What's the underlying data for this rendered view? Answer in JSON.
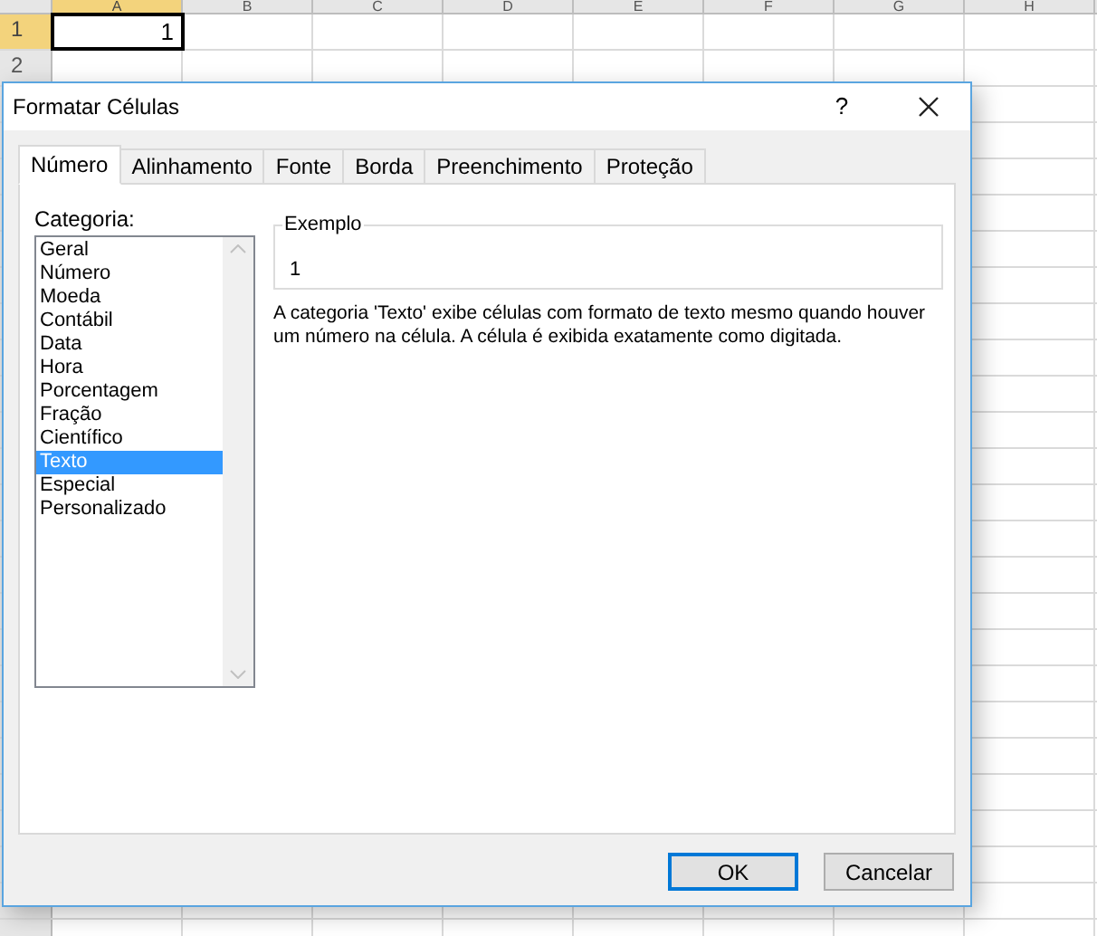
{
  "sheet": {
    "columns": [
      {
        "label": "A",
        "selected": true
      },
      {
        "label": "B",
        "selected": false
      },
      {
        "label": "C",
        "selected": false
      },
      {
        "label": "D",
        "selected": false
      },
      {
        "label": "E",
        "selected": false
      },
      {
        "label": "F",
        "selected": false
      },
      {
        "label": "G",
        "selected": false
      },
      {
        "label": "H",
        "selected": false
      }
    ],
    "rows": [
      {
        "number": "1",
        "value": "1",
        "selected": true
      },
      {
        "number": "2",
        "value": "",
        "selected": false
      }
    ]
  },
  "dialog": {
    "title": "Formatar Células",
    "help": "?",
    "tabs": [
      {
        "label": "Número",
        "selected": true
      },
      {
        "label": "Alinhamento",
        "selected": false
      },
      {
        "label": "Fonte",
        "selected": false
      },
      {
        "label": "Borda",
        "selected": false
      },
      {
        "label": "Preenchimento",
        "selected": false
      },
      {
        "label": "Proteção",
        "selected": false
      }
    ],
    "category_label": "Categoria:",
    "categories": [
      {
        "label": "Geral",
        "selected": false
      },
      {
        "label": "Número",
        "selected": false
      },
      {
        "label": "Moeda",
        "selected": false
      },
      {
        "label": "Contábil",
        "selected": false
      },
      {
        "label": "Data",
        "selected": false
      },
      {
        "label": "Hora",
        "selected": false
      },
      {
        "label": "Porcentagem",
        "selected": false
      },
      {
        "label": "Fração",
        "selected": false
      },
      {
        "label": "Científico",
        "selected": false
      },
      {
        "label": "Texto",
        "selected": true
      },
      {
        "label": "Especial",
        "selected": false
      },
      {
        "label": "Personalizado",
        "selected": false
      }
    ],
    "sample": {
      "label": "Exemplo",
      "value": "1"
    },
    "description": "A categoria 'Texto' exibe células com formato de texto mesmo quando houver um número na célula. A célula é exibida exatamente como digitada.",
    "buttons": [
      {
        "label": "OK",
        "default": true
      },
      {
        "label": "Cancelar",
        "default": false
      }
    ]
  }
}
